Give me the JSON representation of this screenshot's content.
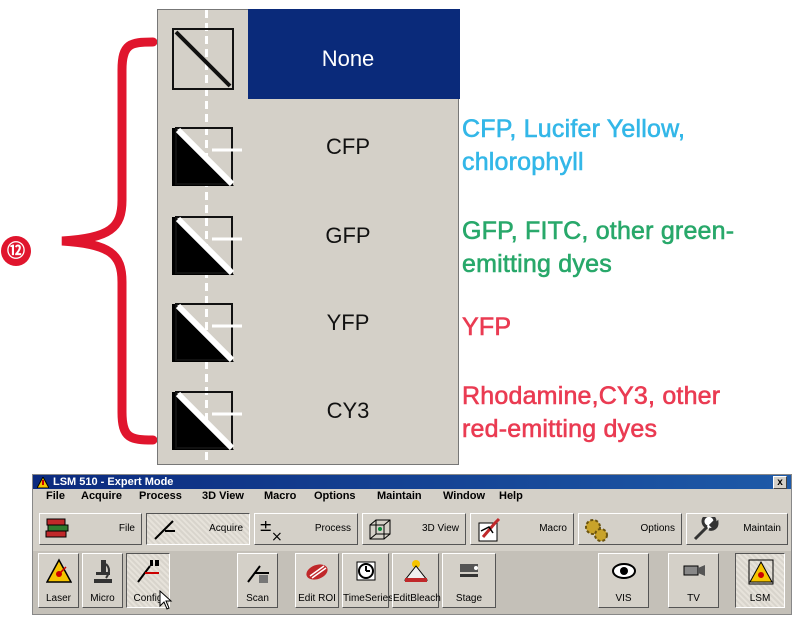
{
  "callout": {
    "number": "⑫"
  },
  "filter_menu": {
    "items": [
      {
        "label": "None",
        "selected": true
      },
      {
        "label": "CFP",
        "selected": false
      },
      {
        "label": "GFP",
        "selected": false
      },
      {
        "label": "YFP",
        "selected": false
      },
      {
        "label": "CY3",
        "selected": false
      }
    ]
  },
  "descriptions": [
    {
      "line1": "CFP, Lucifer Yellow,",
      "line2": "chlorophyll",
      "color": "#33b7e8"
    },
    {
      "line1": "GFP, FITC, other green-",
      "line2": "emitting dyes",
      "color": "#28a86a"
    },
    {
      "line1": "YFP",
      "line2": "",
      "color": "#ea3b52"
    },
    {
      "line1": "Rhodamine,CY3, other",
      "line2": "red-emitting dyes",
      "color": "#ea3b52"
    }
  ],
  "colors": {
    "brace": "#e0152d",
    "selection": "#0a2a7a"
  },
  "window": {
    "title": "LSM 510 - Expert Mode",
    "close_label": "x",
    "menu": [
      "File",
      "Acquire",
      "Process",
      "3D View",
      "Macro",
      "Options",
      "Maintain",
      "Window",
      "Help"
    ],
    "toolbar": [
      {
        "label": "File",
        "icon": "books-icon",
        "pressed": false
      },
      {
        "label": "Acquire",
        "icon": "acquire-icon",
        "pressed": true
      },
      {
        "label": "Process",
        "icon": "process-icon",
        "pressed": false
      },
      {
        "label": "3D View",
        "icon": "cube-icon",
        "pressed": false
      },
      {
        "label": "Macro",
        "icon": "macro-icon",
        "pressed": false
      },
      {
        "label": "Options",
        "icon": "gears-icon",
        "pressed": false
      },
      {
        "label": "Maintain",
        "icon": "wrench-icon",
        "pressed": false
      }
    ],
    "buttons": [
      {
        "label": "Laser",
        "icon": "laser-warning-icon",
        "pressed": false
      },
      {
        "label": "Micro",
        "icon": "microscope-icon",
        "pressed": false
      },
      {
        "label": "Config",
        "icon": "config-icon",
        "pressed": true
      },
      {
        "label": "Scan",
        "icon": "scan-icon",
        "pressed": false
      },
      {
        "label": "Edit ROI",
        "icon": "roi-icon",
        "pressed": false
      },
      {
        "label": "TimeSeries",
        "icon": "timer-icon",
        "pressed": false
      },
      {
        "label": "EditBleach",
        "icon": "bleach-icon",
        "pressed": false
      },
      {
        "label": "Stage",
        "icon": "stage-icon",
        "pressed": false
      },
      {
        "label": "VIS",
        "icon": "eye-icon",
        "pressed": false
      },
      {
        "label": "TV",
        "icon": "camera-icon",
        "pressed": false
      },
      {
        "label": "LSM",
        "icon": "lsm-icon",
        "pressed": true
      }
    ]
  }
}
